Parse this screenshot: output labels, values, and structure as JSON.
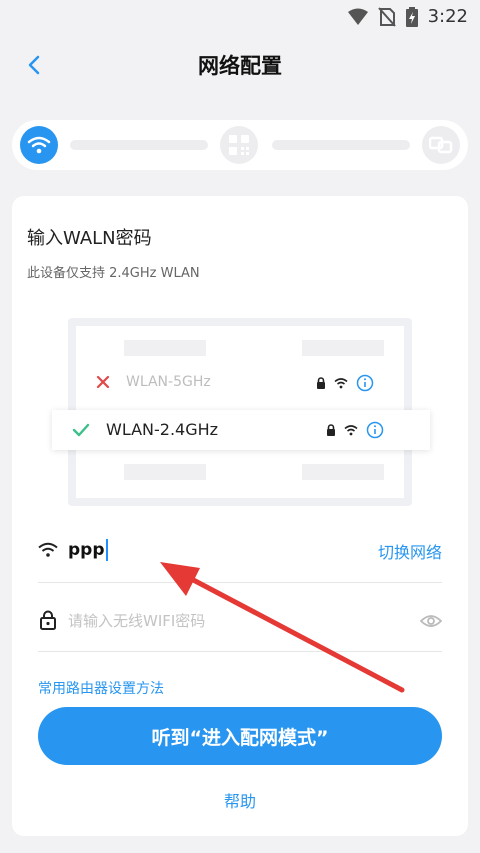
{
  "status_bar": {
    "time": "3:22"
  },
  "header": {
    "title": "网络配置"
  },
  "stepper": {
    "active_step": 1,
    "icons": [
      "wifi-icon",
      "qr-code-icon",
      "device-link-icon"
    ]
  },
  "card": {
    "title": "输入WALN密码",
    "subtitle": "此设备仅支持 2.4GHz WLAN",
    "illustration": {
      "bad_network": "WLAN-5GHz",
      "good_network": "WLAN-2.4GHz"
    },
    "ssid": {
      "value": "ppp",
      "switch_label": "切换网络"
    },
    "password": {
      "placeholder": "请输入无线WIFI密码",
      "value": ""
    },
    "router_link": "常用路由器设置方法",
    "primary_button": "听到“进入配网模式”",
    "help_link": "帮助"
  },
  "colors": {
    "accent": "#2896f0",
    "error": "#e04a4a",
    "success": "#3cc08a",
    "annotation_arrow": "#e53935"
  }
}
